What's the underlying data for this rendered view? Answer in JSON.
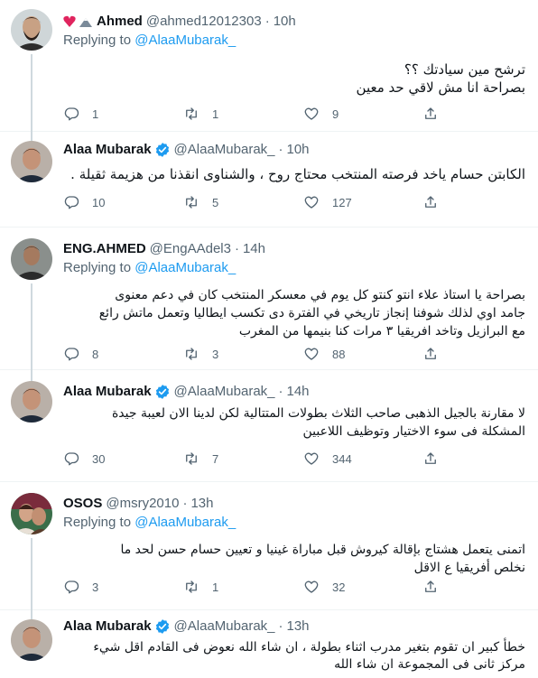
{
  "reply_prefix": "Replying to",
  "tweets": [
    {
      "name": "Ahmed",
      "emoji": "❤️🏔",
      "handle": "@ahmed12012303",
      "time": "10h",
      "replying_to": "@AlaaMubarak_",
      "lines": [
        "ترشح مين سيادتك ؟؟",
        "بصراحة انا مش لاقي حد معين"
      ],
      "replies": "1",
      "retweets": "1",
      "likes": "9"
    },
    {
      "name": "Alaa Mubarak",
      "handle": "@AlaaMubarak_",
      "time": "10h",
      "lines": [
        "الكابتن حسام ياخد فرصته المنتخب محتاج روح ، والشناوى انقذنا من هزيمة ثقيلة ."
      ],
      "replies": "10",
      "retweets": "5",
      "likes": "127"
    },
    {
      "name": "ENG.AHMED",
      "handle": "@EngAAdel3",
      "time": "14h",
      "replying_to": "@AlaaMubarak_",
      "lines": [
        "بصراحة يا استاذ علاء انتو كنتو كل يوم في معسكر المنتخب كان في دعم معنوى",
        "جامد اوي لذلك شوفنا إنجاز تاريخي في الفترة دى تكسب ايطاليا وتعمل ماتش رائع",
        "مع البرازيل وتاخد افريقيا ٣ مرات كنا بنيمها من المغرب"
      ],
      "replies": "8",
      "retweets": "3",
      "likes": "88"
    },
    {
      "name": "Alaa Mubarak",
      "handle": "@AlaaMubarak_",
      "time": "14h",
      "lines": [
        "لا مقارنة بالجيل الذهبى صاحب الثلاث بطولات المتتالية لكن لدينا الان لعيبة جيدة",
        "المشكلة  فى سوء الاختيار وتوظيف اللاعبين"
      ],
      "replies": "30",
      "retweets": "7",
      "likes": "344"
    },
    {
      "name": "OSOS",
      "handle": "@msry2010",
      "time": "13h",
      "replying_to": "@AlaaMubarak_",
      "lines": [
        "اتمنى يتعمل هشتاج بإقالة كيروش قبل مباراة غينيا و تعيين حسام حسن لحد ما",
        "نخلص أفريقيا ع الاقل"
      ],
      "replies": "3",
      "retweets": "1",
      "likes": "32"
    },
    {
      "name": "Alaa Mubarak",
      "handle": "@AlaaMubarak_",
      "time": "13h",
      "lines": [
        "خطأ كبير ان تقوم بتغير مدرب اثناء بطولة ، ان شاء الله نعوض فى القادم اقل شيء",
        "مركز ثانى فى المجموعة ان شاء الله"
      ]
    }
  ],
  "colors": {
    "accent": "#1d9bf0",
    "secondary_text": "#536471",
    "thread_line": "#cfd9de",
    "emoji_heart": "#e0245e"
  },
  "icons": [
    "reply-icon",
    "retweet-icon",
    "like-icon",
    "share-icon",
    "verified-badge-icon"
  ]
}
